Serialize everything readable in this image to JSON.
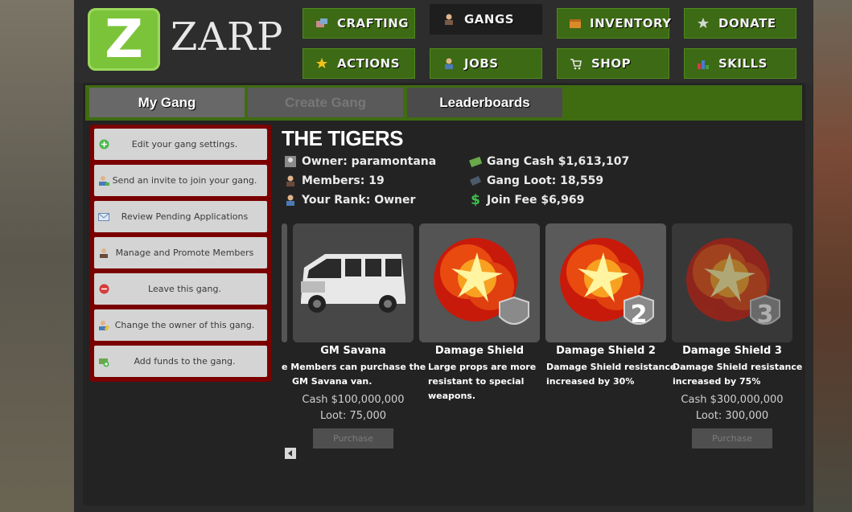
{
  "brand": {
    "logo_letter": "Z",
    "name": "ZARP"
  },
  "nav": [
    {
      "label": "CRAFTING",
      "icon": "crafting-icon"
    },
    {
      "label": "GANGS",
      "icon": "gangs-icon"
    },
    {
      "label": "INVENTORY",
      "icon": "inventory-icon"
    },
    {
      "label": "DONATE",
      "icon": "donate-icon"
    },
    {
      "label": "ACTIONS",
      "icon": "star-icon"
    },
    {
      "label": "JOBS",
      "icon": "jobs-icon"
    },
    {
      "label": "SHOP",
      "icon": "cart-icon"
    },
    {
      "label": "SKILLS",
      "icon": "skills-chart-icon"
    }
  ],
  "tabs": [
    {
      "label": "My Gang"
    },
    {
      "label": "Create Gang"
    },
    {
      "label": "Leaderboards"
    }
  ],
  "side_menu": [
    {
      "label": "Edit your gang settings.",
      "icon": "plus-circle-icon"
    },
    {
      "label": "Send an invite to join your gang.",
      "icon": "user-add-icon"
    },
    {
      "label": "Review Pending Applications",
      "icon": "envelope-icon"
    },
    {
      "label": "Manage and Promote Members",
      "icon": "user-icon"
    },
    {
      "label": "Leave this gang.",
      "icon": "minus-circle-icon"
    },
    {
      "label": "Change the owner of this gang.",
      "icon": "user-edit-icon"
    },
    {
      "label": "Add funds to the gang.",
      "icon": "money-add-icon"
    }
  ],
  "gang": {
    "name": "THE TIGERS",
    "owner": "Owner: paramontana",
    "members": "Members: 19",
    "rank": "Your Rank: Owner",
    "cash": "Gang Cash $1,613,107",
    "loot": "Gang Loot: 18,559",
    "join_fee": "Join Fee $6,969"
  },
  "upgrades": [
    {
      "title": "GM Savana",
      "desc_line1": "e Members can purchase the",
      "desc_line2": "GM Savana van.",
      "cash": "Cash $100,000,000",
      "loot": "Loot: 75,000",
      "button": "Purchase"
    },
    {
      "title": "Damage Shield",
      "desc_line1": "Large props are more",
      "desc_line2": "resistant to special",
      "desc_line3": "weapons."
    },
    {
      "title": "Damage Shield 2",
      "desc_line1": "Damage Shield resistance",
      "desc_line2": "increased by 30%",
      "badge": "2"
    },
    {
      "title": "Damage Shield 3",
      "desc_line1": "Damage Shield resistance",
      "desc_line2": "increased by 75%",
      "badge": "3",
      "cash": "Cash $300,000,000",
      "loot": "Loot: 300,000",
      "button": "Purchase"
    }
  ],
  "colors": {
    "nav_green": "#3d6a14",
    "side_border": "#7a0000",
    "logo_green": "#7bc43a"
  }
}
